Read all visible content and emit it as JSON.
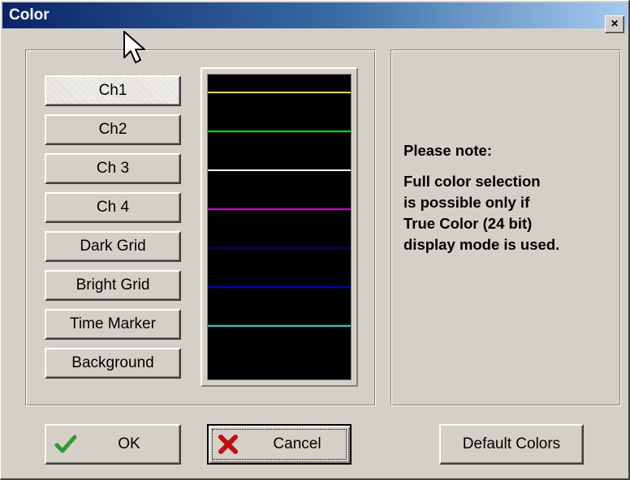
{
  "window": {
    "title": "Color",
    "close_label": "×"
  },
  "channels": {
    "buttons": [
      {
        "label": "Ch1",
        "color": "#e8e000"
      },
      {
        "label": "Ch2",
        "color": "#00e000"
      },
      {
        "label": "Ch 3",
        "color": "#ffffff"
      },
      {
        "label": "Ch 4",
        "color": "#e000e0"
      },
      {
        "label": "Dark Grid",
        "color": "#000080"
      },
      {
        "label": "Bright Grid",
        "color": "#0000e0"
      },
      {
        "label": "Time Marker",
        "color": "#00e0e0"
      },
      {
        "label": "Background",
        "color": "#000000"
      }
    ],
    "selected": "Ch1"
  },
  "note": {
    "lines": [
      "Please note:",
      "Full color selection",
      "is possible only if",
      "True Color (24 bit)",
      "display mode is used."
    ]
  },
  "footer": {
    "ok_label": "OK",
    "cancel_label": "Cancel",
    "default_label": "Default Colors"
  },
  "icons": {
    "ok_icon": "check-icon",
    "cancel_icon": "x-icon",
    "close_icon": "close-icon"
  },
  "colors": {
    "title_gradient_start": "#0a246a",
    "title_gradient_end": "#a6caf0",
    "dialog_background": "#d4d0c8",
    "preview_background": "#000000",
    "check_green": "#2e9a2e",
    "x_red": "#c01010"
  }
}
